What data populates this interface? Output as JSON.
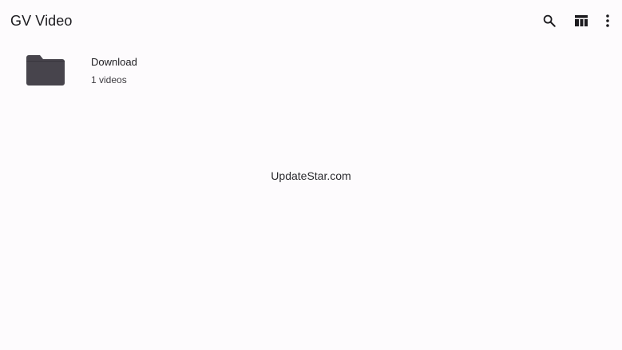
{
  "app": {
    "title": "GV Video"
  },
  "toolbar": {
    "actions": [
      {
        "icon": "search-icon",
        "label": "Search"
      },
      {
        "icon": "layout-icon",
        "label": "Layout"
      },
      {
        "icon": "more-vert-icon",
        "label": "More options"
      }
    ]
  },
  "folders": [
    {
      "name": "Download",
      "count": "1 videos",
      "icon": "folder-icon"
    }
  ],
  "watermark": "UpdateStar.com",
  "colors": {
    "background": "#fdfbfd",
    "folder": "#47444c",
    "text": "#1c1b1f",
    "icon": "#1c1b1f"
  }
}
